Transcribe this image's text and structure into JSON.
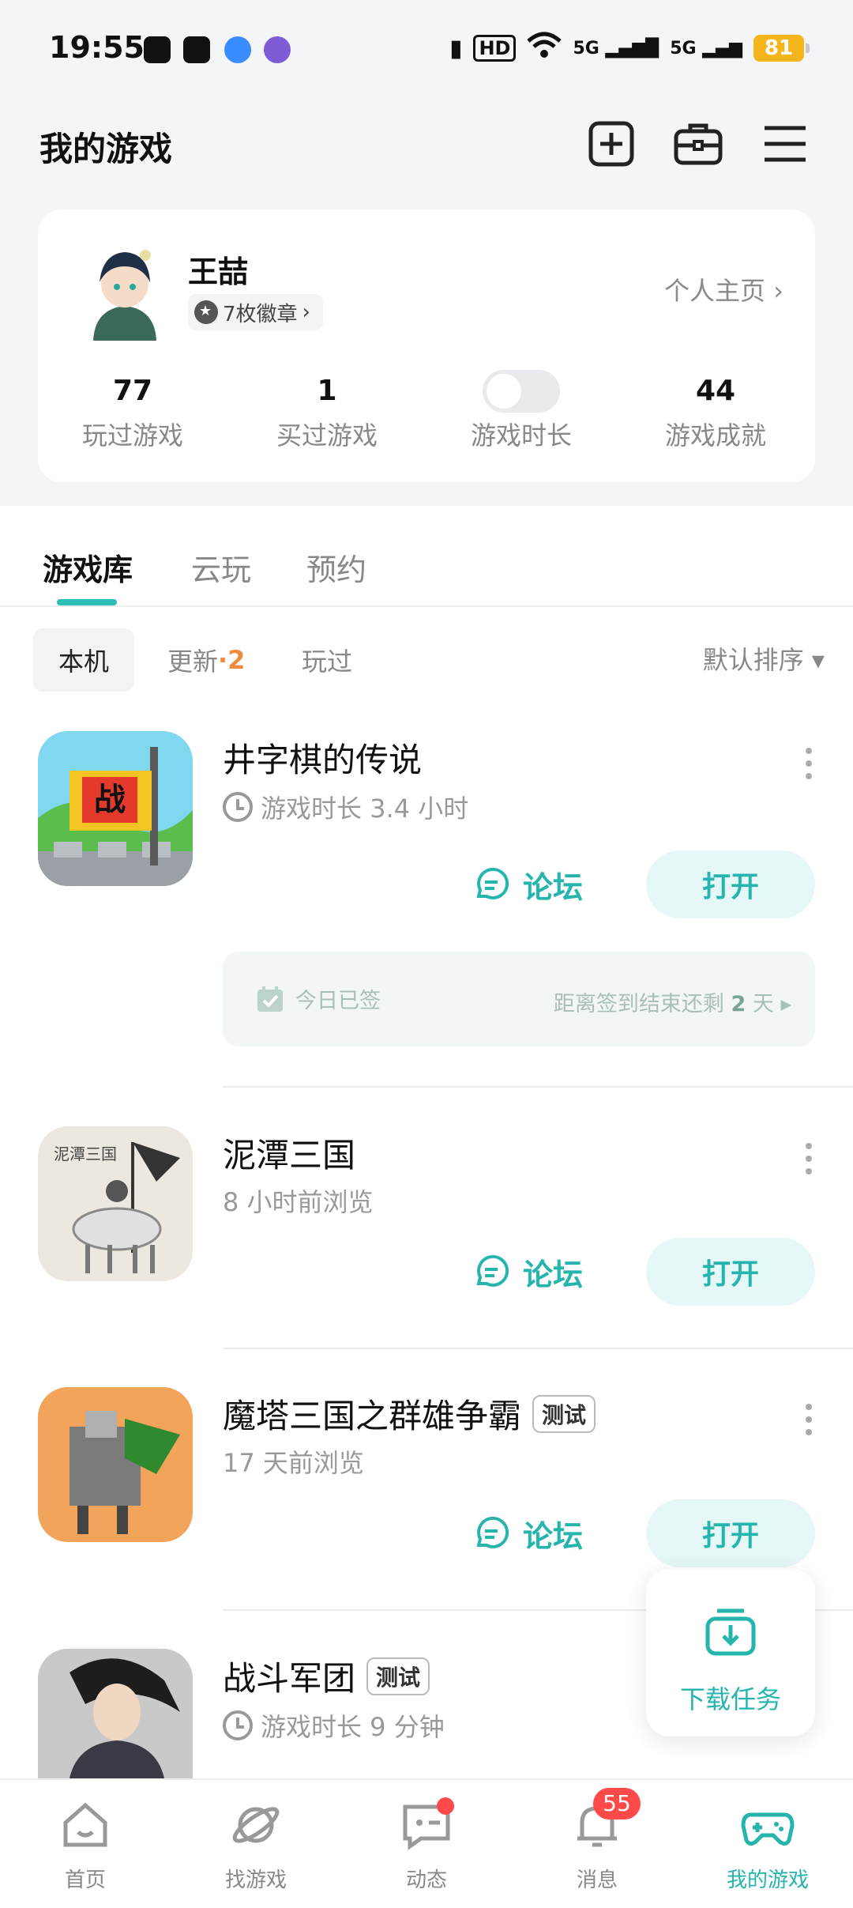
{
  "status_bar": {
    "time": "19:55",
    "battery": "81",
    "hd_label": "HD",
    "signal_1": "5G",
    "signal_2": "5G"
  },
  "header": {
    "title": "我的游戏"
  },
  "profile": {
    "name": "王喆",
    "badges": "7枚徽章",
    "homepage_link": "个人主页",
    "stats": [
      {
        "value": "77",
        "label": "玩过游戏"
      },
      {
        "value": "1",
        "label": "买过游戏"
      },
      {
        "value": "",
        "label": "游戏时长",
        "toggle_on": false
      },
      {
        "value": "44",
        "label": "游戏成就"
      }
    ]
  },
  "tabs": [
    {
      "label": "游戏库",
      "active": true
    },
    {
      "label": "云玩",
      "active": false
    },
    {
      "label": "预约",
      "active": false
    }
  ],
  "sub_tabs": {
    "local": "本机",
    "update": "更新",
    "update_sep": "·",
    "update_count": "2",
    "played": "玩过",
    "sort": "默认排序 ▾"
  },
  "games": [
    {
      "name": "井字棋的传说",
      "tag": "",
      "subtitle": "游戏时长 3.4 小时",
      "show_clock": true,
      "forum": "论坛",
      "open": "打开",
      "checkin": {
        "status": "今日已签",
        "remaining_prefix": "距离签到结束还剩",
        "remaining_value": "2",
        "remaining_suffix": "天"
      }
    },
    {
      "name": "泥潭三国",
      "tag": "",
      "subtitle": "8 小时前浏览",
      "show_clock": false,
      "forum": "论坛",
      "open": "打开"
    },
    {
      "name": "魔塔三国之群雄争霸",
      "tag": "测试",
      "subtitle": "17 天前浏览",
      "show_clock": false,
      "forum": "论坛",
      "open": "打开"
    },
    {
      "name": "战斗军团",
      "tag": "测试",
      "subtitle": "游戏时长 9 分钟",
      "show_clock": true
    }
  ],
  "download_task": "下载任务",
  "bottom_nav": [
    {
      "label": "首页",
      "icon": "home-icon"
    },
    {
      "label": "找游戏",
      "icon": "planet-icon"
    },
    {
      "label": "动态",
      "icon": "chat-icon",
      "dot": true
    },
    {
      "label": "消息",
      "icon": "bell-icon",
      "badge": "55"
    },
    {
      "label": "我的游戏",
      "icon": "gamepad-icon",
      "active": true
    }
  ],
  "colors": {
    "accent": "#25b5ad",
    "badge_red": "#ff4a4a",
    "update_orange": "#f08a3c",
    "battery_yellow": "#f5b51c"
  }
}
